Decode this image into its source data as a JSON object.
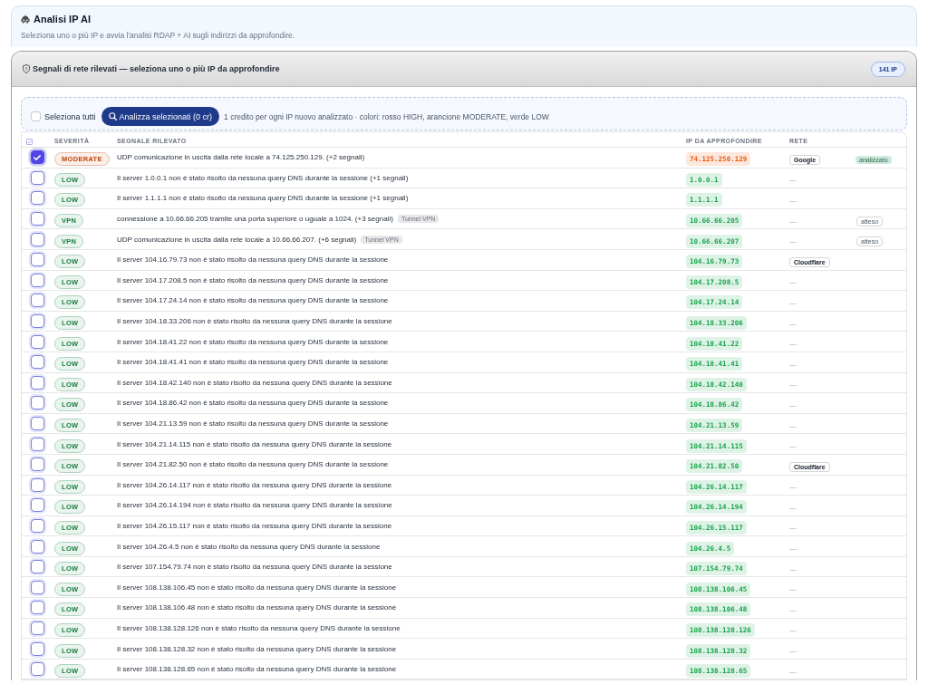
{
  "header": {
    "title": "Analisi IP AI",
    "subtitle": "Seleziona uno o più IP e avvia l'analisi RDAP + AI sugli indirizzi da approfondire."
  },
  "panel": {
    "title": "Segnali di rete rilevati — seleziona uno o più IP da approfondire",
    "count_badge": "141 IP"
  },
  "toolbar": {
    "select_all": {
      "label": "Seleziona tutti",
      "checked": false
    },
    "analyze_button": "Analizza selezionati (0 cr)",
    "hint": "1 credito per ogni IP nuovo analizzato · colori: rosso HIGH, arancione MODERATE, verde LOW"
  },
  "table": {
    "columns": [
      "SEVERITÀ",
      "SEGNALE RILEVATO",
      "IP DA APPROFONDIRE",
      "RETE"
    ],
    "rows": [
      {
        "checked": true,
        "severity": {
          "label": "MODERATE",
          "color": "#c2410c"
        },
        "signal": "UDP comunicazione in uscita dalla rete locale a 74.125.250.129. (+2 segnali)",
        "ip": {
          "text": "74.125.250.129",
          "color": "#ea580c"
        },
        "network": {
          "kind": "badge",
          "text": "Google"
        },
        "status": {
          "kind": "done",
          "label": "analizzato"
        }
      },
      {
        "checked": false,
        "severity": {
          "label": "LOW",
          "color": "#15803d"
        },
        "signal": "Il server 1.0.0.1 non è stato risolto da nessuna query DNS durante la sessione (+1 segnali)",
        "ip": {
          "text": "1.0.0.1",
          "color": "#16a34a"
        },
        "network": {
          "kind": "none",
          "text": "—"
        }
      },
      {
        "checked": false,
        "severity": {
          "label": "LOW",
          "color": "#15803d"
        },
        "signal": "Il server 1.1.1.1 non è stato risolto da nessuna query DNS durante la sessione (+1 segnali)",
        "ip": {
          "text": "1.1.1.1",
          "color": "#16a34a"
        },
        "network": {
          "kind": "none",
          "text": "—"
        }
      },
      {
        "checked": false,
        "severity": {
          "label": "VPN",
          "color": "#15803d"
        },
        "signal": "connessione a 10.66.66.205 tramite una porta superiore o uguale a 1024. (+3 segnali)",
        "tag": "Tunnel VPN",
        "ip": {
          "text": "10.66.66.205",
          "color": "#16a34a"
        },
        "network": {
          "kind": "none",
          "text": "—"
        },
        "status": {
          "kind": "pending",
          "label": "atteso"
        }
      },
      {
        "checked": false,
        "severity": {
          "label": "VPN",
          "color": "#15803d"
        },
        "signal": "UDP comunicazione in uscita dalla rete locale a 10.66.66.207. (+6 segnali)",
        "tag": "Tunnel VPN",
        "ip": {
          "text": "10.66.66.207",
          "color": "#16a34a"
        },
        "network": {
          "kind": "none",
          "text": "—"
        },
        "status": {
          "kind": "pending",
          "label": "atteso"
        }
      },
      {
        "checked": false,
        "severity": {
          "label": "LOW",
          "color": "#15803d"
        },
        "signal": "Il server 104.16.79.73 non è stato risolto da nessuna query DNS durante la sessione",
        "ip": {
          "text": "104.16.79.73",
          "color": "#16a34a"
        },
        "network": {
          "kind": "badge",
          "text": "Cloudflare"
        }
      },
      {
        "checked": false,
        "severity": {
          "label": "LOW",
          "color": "#15803d"
        },
        "signal": "Il server 104.17.208.5 non è stato risolto da nessuna query DNS durante la sessione",
        "ip": {
          "text": "104.17.208.5",
          "color": "#16a34a"
        },
        "network": {
          "kind": "none",
          "text": "—"
        }
      },
      {
        "checked": false,
        "severity": {
          "label": "LOW",
          "color": "#15803d"
        },
        "signal": "Il server 104.17.24.14 non è stato risolto da nessuna query DNS durante la sessione",
        "ip": {
          "text": "104.17.24.14",
          "color": "#16a34a"
        },
        "network": {
          "kind": "none",
          "text": "—"
        }
      },
      {
        "checked": false,
        "severity": {
          "label": "LOW",
          "color": "#15803d"
        },
        "signal": "Il server 104.18.33.206 non è stato risolto da nessuna query DNS durante la sessione",
        "ip": {
          "text": "104.18.33.206",
          "color": "#16a34a"
        },
        "network": {
          "kind": "none",
          "text": "—"
        }
      },
      {
        "checked": false,
        "severity": {
          "label": "LOW",
          "color": "#15803d"
        },
        "signal": "Il server 104.18.41.22 non è stato risolto da nessuna query DNS durante la sessione",
        "ip": {
          "text": "104.18.41.22",
          "color": "#16a34a"
        },
        "network": {
          "kind": "none",
          "text": "—"
        }
      },
      {
        "checked": false,
        "severity": {
          "label": "LOW",
          "color": "#15803d"
        },
        "signal": "Il server 104.18.41.41 non è stato risolto da nessuna query DNS durante la sessione",
        "ip": {
          "text": "104.18.41.41",
          "color": "#16a34a"
        },
        "network": {
          "kind": "none",
          "text": "—"
        }
      },
      {
        "checked": false,
        "severity": {
          "label": "LOW",
          "color": "#15803d"
        },
        "signal": "Il server 104.18.42.140 non è stato risolto da nessuna query DNS durante la sessione",
        "ip": {
          "text": "104.18.42.140",
          "color": "#16a34a"
        },
        "network": {
          "kind": "none",
          "text": "—"
        }
      },
      {
        "checked": false,
        "severity": {
          "label": "LOW",
          "color": "#15803d"
        },
        "signal": "Il server 104.18.86.42 non è stato risolto da nessuna query DNS durante la sessione",
        "ip": {
          "text": "104.18.86.42",
          "color": "#16a34a"
        },
        "network": {
          "kind": "none",
          "text": "—"
        }
      },
      {
        "checked": false,
        "severity": {
          "label": "LOW",
          "color": "#15803d"
        },
        "signal": "Il server 104.21.13.59 non è stato risolto da nessuna query DNS durante la sessione",
        "ip": {
          "text": "104.21.13.59",
          "color": "#16a34a"
        },
        "network": {
          "kind": "none",
          "text": "—"
        }
      },
      {
        "checked": false,
        "severity": {
          "label": "LOW",
          "color": "#15803d"
        },
        "signal": "Il server 104.21.14.115 non è stato risolto da nessuna query DNS durante la sessione",
        "ip": {
          "text": "104.21.14.115",
          "color": "#16a34a"
        },
        "network": {
          "kind": "none",
          "text": "—"
        }
      },
      {
        "checked": false,
        "severity": {
          "label": "LOW",
          "color": "#15803d"
        },
        "signal": "Il server 104.21.82.50 non è stato risolto da nessuna query DNS durante la sessione",
        "ip": {
          "text": "104.21.82.50",
          "color": "#16a34a"
        },
        "network": {
          "kind": "badge",
          "text": "Cloudflare"
        }
      },
      {
        "checked": false,
        "severity": {
          "label": "LOW",
          "color": "#15803d"
        },
        "signal": "Il server 104.26.14.117 non è stato risolto da nessuna query DNS durante la sessione",
        "ip": {
          "text": "104.26.14.117",
          "color": "#16a34a"
        },
        "network": {
          "kind": "none",
          "text": "—"
        }
      },
      {
        "checked": false,
        "severity": {
          "label": "LOW",
          "color": "#15803d"
        },
        "signal": "Il server 104.26.14.194 non è stato risolto da nessuna query DNS durante la sessione",
        "ip": {
          "text": "104.26.14.194",
          "color": "#16a34a"
        },
        "network": {
          "kind": "none",
          "text": "—"
        }
      },
      {
        "checked": false,
        "severity": {
          "label": "LOW",
          "color": "#15803d"
        },
        "signal": "Il server 104.26.15.117 non è stato risolto da nessuna query DNS durante la sessione",
        "ip": {
          "text": "104.26.15.117",
          "color": "#16a34a"
        },
        "network": {
          "kind": "none",
          "text": "—"
        }
      },
      {
        "checked": false,
        "severity": {
          "label": "LOW",
          "color": "#15803d"
        },
        "signal": "Il server 104.26.4.5 non è stato risolto da nessuna query DNS durante la sessione",
        "ip": {
          "text": "104.26.4.5",
          "color": "#16a34a"
        },
        "network": {
          "kind": "none",
          "text": "—"
        }
      },
      {
        "checked": false,
        "severity": {
          "label": "LOW",
          "color": "#15803d"
        },
        "signal": "Il server 107.154.79.74 non è stato risolto da nessuna query DNS durante la sessione",
        "ip": {
          "text": "107.154.79.74",
          "color": "#16a34a"
        },
        "network": {
          "kind": "none",
          "text": "—"
        }
      },
      {
        "checked": false,
        "severity": {
          "label": "LOW",
          "color": "#15803d"
        },
        "signal": "Il server 108.138.106.45 non è stato risolto da nessuna query DNS durante la sessione",
        "ip": {
          "text": "108.138.106.45",
          "color": "#16a34a"
        },
        "network": {
          "kind": "none",
          "text": "—"
        }
      },
      {
        "checked": false,
        "severity": {
          "label": "LOW",
          "color": "#15803d"
        },
        "signal": "Il server 108.138.106.48 non è stato risolto da nessuna query DNS durante la sessione",
        "ip": {
          "text": "108.138.106.48",
          "color": "#16a34a"
        },
        "network": {
          "kind": "none",
          "text": "—"
        }
      },
      {
        "checked": false,
        "severity": {
          "label": "LOW",
          "color": "#15803d"
        },
        "signal": "Il server 108.138.128.126 non è stato risolto da nessuna query DNS durante la sessione",
        "ip": {
          "text": "108.138.128.126",
          "color": "#16a34a"
        },
        "network": {
          "kind": "none",
          "text": "—"
        }
      },
      {
        "checked": false,
        "severity": {
          "label": "LOW",
          "color": "#15803d"
        },
        "signal": "Il server 108.138.128.32 non è stato risolto da nessuna query DNS durante la sessione",
        "ip": {
          "text": "108.138.128.32",
          "color": "#16a34a"
        },
        "network": {
          "kind": "none",
          "text": "—"
        }
      },
      {
        "checked": false,
        "severity": {
          "label": "LOW",
          "color": "#15803d"
        },
        "signal": "Il server 108.138.128.65 non è stato risolto da nessuna query DNS durante la sessione",
        "ip": {
          "text": "108.138.128.65",
          "color": "#16a34a"
        },
        "network": {
          "kind": "none",
          "text": "—"
        }
      }
    ]
  }
}
